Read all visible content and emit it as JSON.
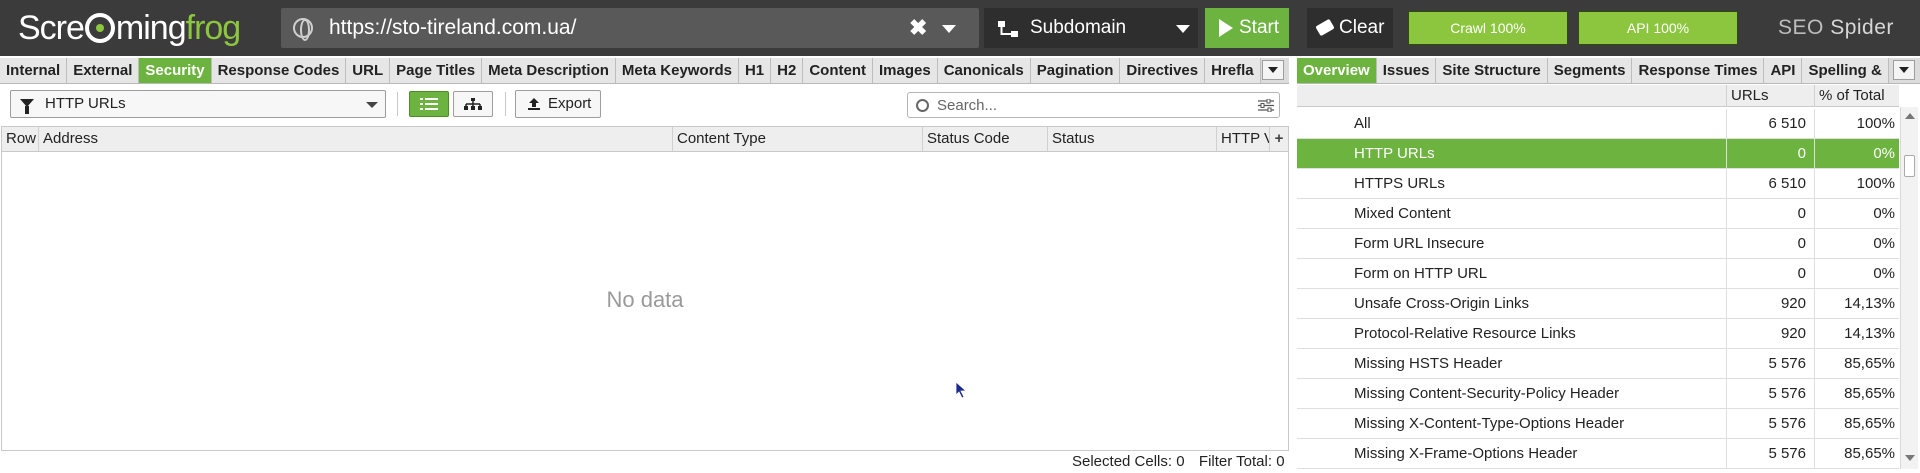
{
  "app": {
    "logo_part1": "Scre",
    "logo_part2": "ming",
    "logo_part3": "frog",
    "brand_seo": "SEO",
    "brand_spider": "Spider"
  },
  "toolbar": {
    "url": "https://sto-tireland.com.ua/",
    "mode": "Subdomain",
    "start_label": "Start",
    "clear_label": "Clear",
    "crawl_progress": "Crawl 100%",
    "api_progress": "API 100%"
  },
  "left_tabs": [
    "Internal",
    "External",
    "Security",
    "Response Codes",
    "URL",
    "Page Titles",
    "Meta Description",
    "Meta Keywords",
    "H1",
    "H2",
    "Content",
    "Images",
    "Canonicals",
    "Pagination",
    "Directives",
    "Hrefla"
  ],
  "left_active_tab": "Security",
  "right_tabs": [
    "Overview",
    "Issues",
    "Site Structure",
    "Segments",
    "Response Times",
    "API",
    "Spelling &"
  ],
  "right_active_tab": "Overview",
  "filter": {
    "selected": "HTTP URLs",
    "export_label": "Export",
    "search_placeholder": "Search..."
  },
  "grid": {
    "columns": [
      "Row",
      "Address",
      "Content Type",
      "Status Code",
      "Status",
      "HTTP Ve"
    ],
    "empty_text": "No data"
  },
  "status": {
    "selected_label": "Selected Cells:",
    "selected_value": "0",
    "filter_label": "Filter Total:",
    "filter_value": "0"
  },
  "overview": {
    "col_urls": "URLs",
    "col_pct": "% of Total",
    "rows": [
      {
        "name": "All",
        "urls": "6 510",
        "pct": "100%"
      },
      {
        "name": "HTTP URLs",
        "urls": "0",
        "pct": "0%",
        "selected": true
      },
      {
        "name": "HTTPS URLs",
        "urls": "6 510",
        "pct": "100%"
      },
      {
        "name": "Mixed Content",
        "urls": "0",
        "pct": "0%"
      },
      {
        "name": "Form URL Insecure",
        "urls": "0",
        "pct": "0%"
      },
      {
        "name": "Form on HTTP URL",
        "urls": "0",
        "pct": "0%"
      },
      {
        "name": "Unsafe Cross-Origin Links",
        "urls": "920",
        "pct": "14,13%"
      },
      {
        "name": "Protocol-Relative Resource Links",
        "urls": "920",
        "pct": "14,13%"
      },
      {
        "name": "Missing HSTS Header",
        "urls": "5 576",
        "pct": "85,65%"
      },
      {
        "name": "Missing Content-Security-Policy Header",
        "urls": "5 576",
        "pct": "85,65%"
      },
      {
        "name": "Missing X-Content-Type-Options Header",
        "urls": "5 576",
        "pct": "85,65%"
      },
      {
        "name": "Missing X-Frame-Options Header",
        "urls": "5 576",
        "pct": "85,65%"
      }
    ]
  },
  "colors": {
    "accent": "#6db33f",
    "topbar": "#3b3b3b"
  }
}
